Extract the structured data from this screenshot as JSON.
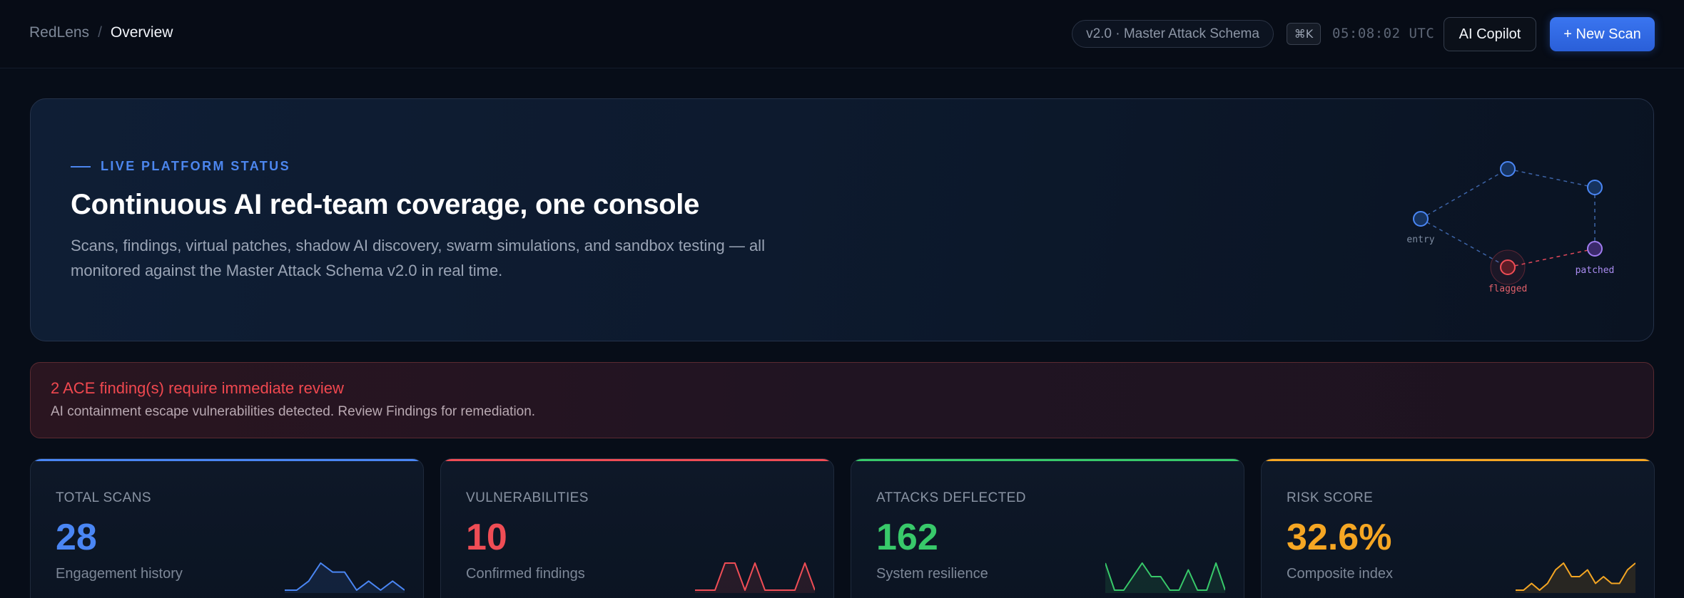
{
  "breadcrumb": {
    "root": "RedLens",
    "separator": "/",
    "current": "Overview"
  },
  "header": {
    "schema_pill": "v2.0 · Master Attack Schema",
    "shortcut": "⌘K",
    "clock": "05:08:02 UTC",
    "copilot_label": "AI Copilot",
    "new_scan_label": "+ New Scan"
  },
  "hero": {
    "kicker": "LIVE PLATFORM STATUS",
    "title": "Continuous AI red-team coverage, one console",
    "description": "Scans, findings, virtual patches, shadow AI discovery, swarm simulations, and sandbox testing — all monitored against the Master Attack Schema v2.0 in real time.",
    "graph_labels": {
      "entry": "entry",
      "flagged": "flagged",
      "patched": "patched"
    }
  },
  "alert": {
    "title": "2 ACE finding(s) require immediate review",
    "body": "AI containment escape vulnerabilities detected. Review Findings for remediation."
  },
  "colors": {
    "blue": "#4a86f4",
    "red": "#ef4d55",
    "green": "#38c96a",
    "amber": "#f5a623"
  },
  "stats": [
    {
      "label": "TOTAL SCANS",
      "value": "28",
      "sub": "Engagement history",
      "color": "#4a86f4",
      "trend": [
        2,
        2,
        3,
        5,
        4,
        4,
        2,
        3,
        2,
        3,
        2
      ]
    },
    {
      "label": "VULNERABILITIES",
      "value": "10",
      "sub": "Confirmed findings",
      "color": "#ef4d55",
      "trend": [
        1,
        1,
        1,
        5,
        5,
        1,
        5,
        1,
        1,
        1,
        1,
        5,
        1
      ]
    },
    {
      "label": "ATTACKS DEFLECTED",
      "value": "162",
      "sub": "System resilience",
      "color": "#38c96a",
      "trend": [
        5,
        1,
        1,
        3,
        5,
        3,
        3,
        1,
        1,
        4,
        1,
        1,
        5,
        1
      ]
    },
    {
      "label": "RISK SCORE",
      "value": "32.6%",
      "sub": "Composite index",
      "color": "#f5a623",
      "trend": [
        1,
        1,
        2,
        1,
        2,
        4,
        5,
        3,
        3,
        4,
        2,
        3,
        2,
        2,
        4,
        5
      ]
    }
  ]
}
